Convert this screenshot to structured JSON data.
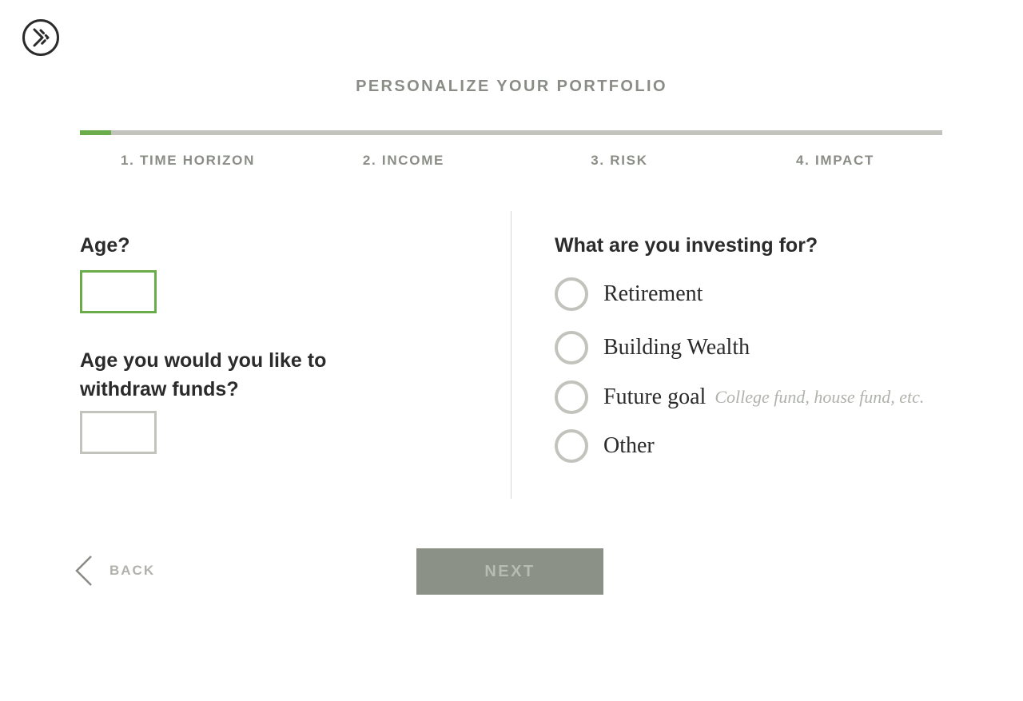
{
  "header": {
    "title": "PERSONALIZE YOUR PORTFOLIO",
    "progress": 0.036
  },
  "steps": [
    {
      "label": "1. TIME HORIZON"
    },
    {
      "label": "2. INCOME"
    },
    {
      "label": "3. RISK"
    },
    {
      "label": "4. IMPACT"
    }
  ],
  "left": {
    "age_label": "Age?",
    "age_value": "",
    "withdraw_label_line1": "Age you would you like to",
    "withdraw_label_line2": "withdraw funds?",
    "withdraw_value": ""
  },
  "right": {
    "question": "What are you investing for?",
    "options": [
      {
        "label": "Retirement",
        "hint": ""
      },
      {
        "label": "Building Wealth",
        "hint": ""
      },
      {
        "label": "Future goal",
        "hint": "College fund, house fund, etc."
      },
      {
        "label": "Other",
        "hint": ""
      }
    ]
  },
  "footer": {
    "back_label": "BACK",
    "next_label": "NEXT"
  },
  "colors": {
    "accent": "#6aac4a",
    "muted": "#8a8d86",
    "border": "#c2c3bc",
    "button": "#8b9187"
  }
}
